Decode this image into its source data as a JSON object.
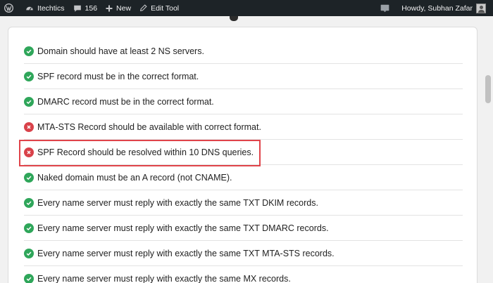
{
  "adminbar": {
    "site_name": "Itechtics",
    "comments_count": "156",
    "new_label": "New",
    "edit_label": "Edit Tool",
    "howdy_label": "Howdy, Subhan Zafar"
  },
  "checks": [
    {
      "text": "Domain should have at least 2 NS servers.",
      "status": "pass"
    },
    {
      "text": "SPF record must be in the correct format.",
      "status": "pass"
    },
    {
      "text": "DMARC record must be in the correct format.",
      "status": "pass"
    },
    {
      "text": "MTA-STS Record should be available with correct format.",
      "status": "fail"
    },
    {
      "text": "SPF Record should be resolved within 10 DNS queries.",
      "status": "fail"
    },
    {
      "text": "Naked domain must be an A record (not CNAME).",
      "status": "pass"
    },
    {
      "text": "Every name server must reply with exactly the same TXT DKIM records.",
      "status": "pass"
    },
    {
      "text": "Every name server must reply with exactly the same TXT DMARC records.",
      "status": "pass"
    },
    {
      "text": "Every name server must reply with exactly the same TXT MTA-STS records.",
      "status": "pass"
    },
    {
      "text": "Every name server must reply with exactly the same MX records.",
      "status": "pass"
    }
  ],
  "colors": {
    "pass": "#2fa65a",
    "fail": "#d9424a",
    "highlight": "#e0444a",
    "adminbar": "#1d2327"
  }
}
